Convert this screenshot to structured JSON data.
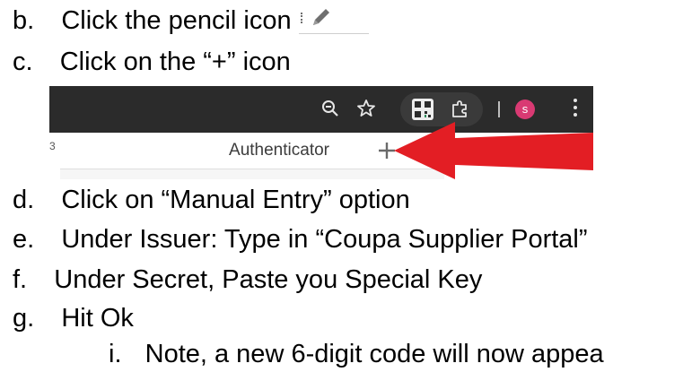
{
  "steps": [
    {
      "marker": "b.",
      "text": "Click the pencil icon"
    },
    {
      "marker": "c.",
      "text": "Click on the “+” icon"
    },
    {
      "marker": "d.",
      "text": "Click on “Manual Entry” option"
    },
    {
      "marker": "e.",
      "text": "Under Issuer: Type in “Coupa Supplier Portal”"
    },
    {
      "marker": "f.",
      "text": "Under Secret, Paste you Special Key"
    },
    {
      "marker": "g.",
      "text": "Hit Ok"
    }
  ],
  "substeps": [
    {
      "marker": "i.",
      "text": "Note, a new 6-digit code will now appea"
    }
  ],
  "inline_icon": {
    "name": "pencil-icon",
    "color": "#6f6f6f"
  },
  "screenshot": {
    "popup_title": "Authenticator",
    "avatar_letter": "s",
    "edge_text": "3",
    "toolbar_icons": [
      "zoom-out-icon",
      "star-icon",
      "qr-code-icon",
      "puzzle-icon",
      "kebab-menu-icon"
    ],
    "colors": {
      "toolbar_bg": "#2b2b2b",
      "avatar_bg": "#d93a73",
      "arrow": "#e31e24"
    }
  }
}
